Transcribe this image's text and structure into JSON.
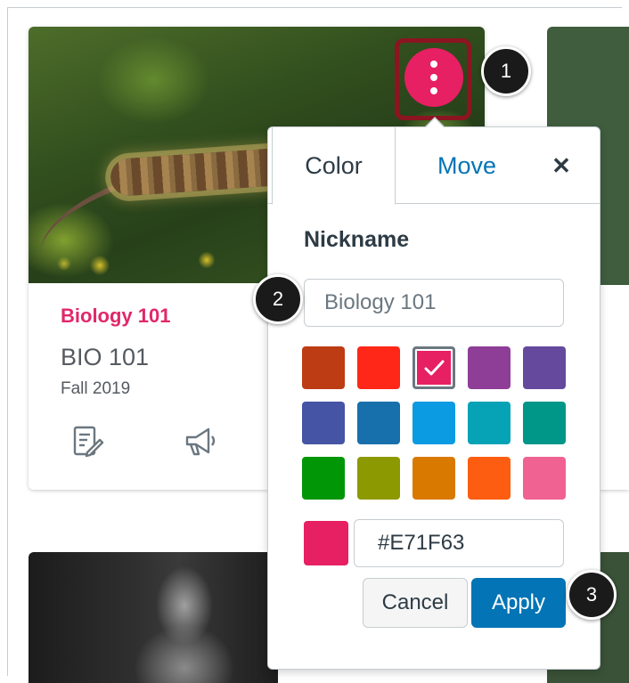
{
  "course_card": {
    "title": "Biology 101",
    "code": "BIO 101",
    "term": "Fall 2019",
    "icons": [
      "assignments-icon",
      "announcements-icon"
    ]
  },
  "options_button": {
    "icon": "kebab-menu-icon",
    "color": "#E71F63"
  },
  "step_callouts": [
    "1",
    "2",
    "3"
  ],
  "popover": {
    "tabs": [
      {
        "label": "Color",
        "selected": true
      },
      {
        "label": "Move",
        "selected": false
      }
    ],
    "close_icon": "close-icon",
    "nickname_label": "Nickname",
    "nickname_placeholder": "Biology 101",
    "swatches": [
      "#BD3C14",
      "#FF2717",
      "#E71F63",
      "#8F3E97",
      "#65499D",
      "#4554A4",
      "#1770AB",
      "#0B9BE3",
      "#06A3B7",
      "#009688",
      "#009606",
      "#8D9900",
      "#D97900",
      "#FD5D10",
      "#F06291"
    ],
    "selected_swatch": "#E71F63",
    "hex_value": "#E71F63",
    "cancel_label": "Cancel",
    "apply_label": "Apply"
  }
}
